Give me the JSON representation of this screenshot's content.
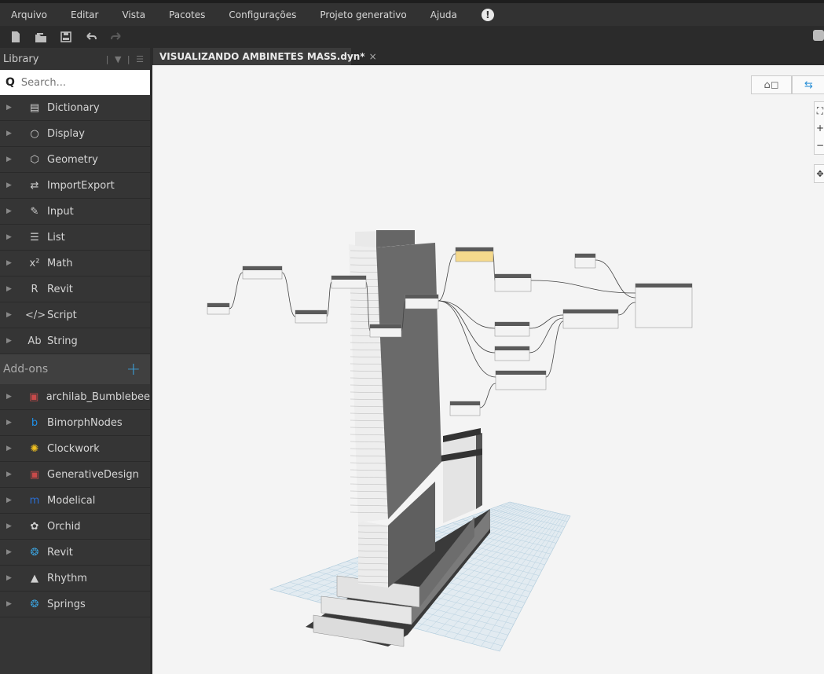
{
  "menu": [
    "Arquivo",
    "Editar",
    "Vista",
    "Pacotes",
    "Configurações",
    "Projeto generativo",
    "Ajuda"
  ],
  "alert_glyph": "!",
  "toolbar": {
    "icons": [
      "new-file-icon",
      "open-folder-icon",
      "save-icon",
      "undo-icon",
      "redo-icon"
    ]
  },
  "library": {
    "title": "Library",
    "search_placeholder": "Search...",
    "categories": [
      {
        "label": "Dictionary",
        "icon": "dictionary-icon"
      },
      {
        "label": "Display",
        "icon": "display-icon"
      },
      {
        "label": "Geometry",
        "icon": "geometry-icon"
      },
      {
        "label": "ImportExport",
        "icon": "import-export-icon"
      },
      {
        "label": "Input",
        "icon": "input-icon"
      },
      {
        "label": "List",
        "icon": "list-icon"
      },
      {
        "label": "Math",
        "icon": "math-icon"
      },
      {
        "label": "Revit",
        "icon": "revit-icon"
      },
      {
        "label": "Script",
        "icon": "script-icon"
      },
      {
        "label": "String",
        "icon": "string-icon"
      }
    ],
    "addons_label": "Add-ons",
    "addons": [
      {
        "label": "archilab_Bumblebee",
        "icon": "bumblebee-icon"
      },
      {
        "label": "BimorphNodes",
        "icon": "bimorph-icon"
      },
      {
        "label": "Clockwork",
        "icon": "clockwork-icon"
      },
      {
        "label": "GenerativeDesign",
        "icon": "generative-design-icon"
      },
      {
        "label": "Modelical",
        "icon": "modelical-icon"
      },
      {
        "label": "Orchid",
        "icon": "orchid-icon"
      },
      {
        "label": "Revit",
        "icon": "revit-package-icon"
      },
      {
        "label": "Rhythm",
        "icon": "rhythm-icon"
      },
      {
        "label": "Springs",
        "icon": "springs-icon"
      }
    ]
  },
  "tab": {
    "title": "VISUALIZANDO AMBINETES MASS.dyn*",
    "close": "×"
  },
  "colors": {
    "accent": "#3b9fd8",
    "canvas_bg": "#f4f4f4",
    "node_header": "#5a5a5a",
    "node_selected": "#f5d98c"
  }
}
